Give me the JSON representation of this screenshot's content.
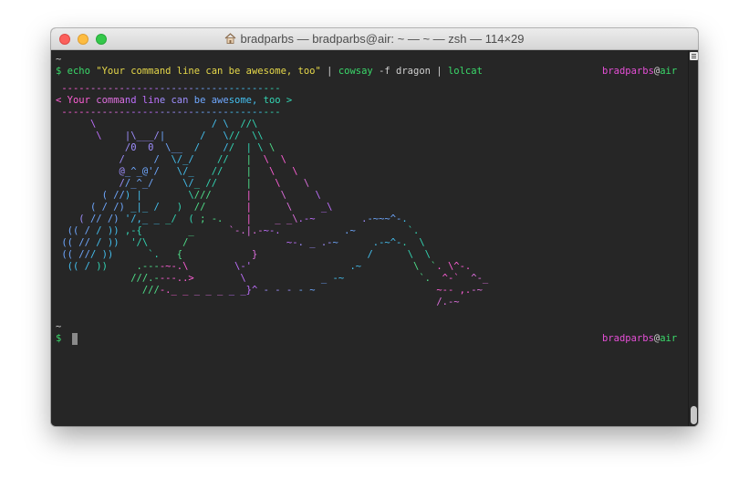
{
  "window": {
    "title": "bradparbs — bradparbs@air: ~ — ~ — zsh — 114×29",
    "icons": {
      "home": "home-icon",
      "close": "close-icon",
      "minimize": "minimize-icon",
      "zoom": "zoom-icon",
      "menu": "scroll-menu-icon"
    }
  },
  "prompt": {
    "tilde1": "~",
    "tilde2": "~",
    "dollar": "$",
    "user": "bradparbs",
    "at": "@",
    "host": "air"
  },
  "command": {
    "echo": "echo",
    "string": "\"Your command line can be awesome, too\"",
    "pipe": "|",
    "cowsay": "cowsay",
    "flag": "-f dragon",
    "lolcat": "lolcat"
  },
  "art_lines": [
    " --------------------------------------",
    "< Your command line can be awesome, too >",
    " --------------------------------------",
    "      \\                    / \\  //\\",
    "       \\    |\\___/|      /   \\//  \\\\",
    "            /0  0  \\__  /    //  | \\ \\",
    "           /     /  \\/_/    //   |  \\  \\",
    "           @_^_@'/   \\/_   //    |   \\   \\",
    "           //_^_/     \\/_ //     |    \\    \\",
    "        ( //) |        \\///      |     \\     \\",
    "      ( / /) _|_ /   )  //       |      \\     _\\",
    "    ( // /) '/,_ _ _/  ( ; -.    |    _ _\\.-~        .-~~~^-.",
    "  (( / / )) ,-{        _      `-.|.-~-.           .~         `.",
    " (( // / ))  '/\\      /                 ~-. _ .-~      .-~^-.  \\",
    " (( /// ))      `.   {            }                   /      \\  \\",
    "  (( / ))     .----~-.\\        \\-'                 .~         \\  `. \\^-.",
    "             ///.----..>        \\             _ -~             `.  ^-`  ^-_",
    "               ///-._ _ _ _ _ _ _}^ - - - - ~                     ~-- ,.-~",
    "                                                                  /.-~"
  ],
  "colors": {
    "background": "#262626",
    "art_gradient": [
      "#ff5fd7",
      "#e070e0",
      "#c070ff",
      "#9f8fff",
      "#6fa8ff",
      "#44c0f0",
      "#33d6b4",
      "#4fe08a"
    ]
  }
}
